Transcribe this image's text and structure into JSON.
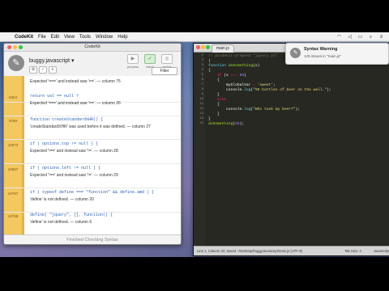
{
  "menubar": {
    "apple_glyph": "",
    "items": [
      "CodeKit",
      "File",
      "Edit",
      "View",
      "Tools",
      "Window",
      "Help"
    ],
    "time": "",
    "icons": [
      "wifi-icon",
      "volume-icon",
      "battery-icon",
      "search-icon",
      "list-icon"
    ]
  },
  "codekit": {
    "window_title": "CodeKit",
    "file_name": "buggy.javascript ▾",
    "file_icon_glyph": "✎",
    "actions": [
      {
        "label": "process",
        "glyph": "▶"
      },
      {
        "label": "check",
        "glyph": "✓"
      },
      {
        "label": "reveal",
        "glyph": "◎"
      }
    ],
    "filter_label": "Filter",
    "errors": [
      {
        "line": "",
        "code": "",
        "message": "Expected '===' and instead saw '=='. — column 75"
      },
      {
        "line": "9304",
        "code": "return val == null ?",
        "message": "Expected '===' and instead saw '=='. — column 26"
      },
      {
        "line": "9768",
        "code": "function createStandardXHR() {",
        "message": "'createStandardXHR' was used before it was defined. — column 27"
      },
      {
        "line": "10673",
        "code": "if ( options.top != null ) {",
        "message": "Expected '!==' and instead saw '!='. — column 28"
      },
      {
        "line": "10697",
        "code": "if ( options.left != null ) {",
        "message": "Expected '!==' and instead saw '!='. — column 29"
      },
      {
        "line": "10797",
        "code": "if ( typeof define === \"function\" && define.amd ) {",
        "message": "'define' is not defined. — column 20"
      },
      {
        "line": "10798",
        "code": "define( \"jquery\", [], function() {",
        "message": "'define' is not defined. — column 6"
      }
    ],
    "status": "Finished Checking Syntax"
  },
  "editor": {
    "tab_label": "main.js",
    "status_left": "Line 1, Column 33; Saved ~/Desktop/buggyJavascript/main.js (UTF-8)",
    "tab_size": "Tab Size: 4",
    "syntax": "JavaScript"
  },
  "notification": {
    "title": "Syntax Warning",
    "message": "125 issues in \"main.js\""
  }
}
